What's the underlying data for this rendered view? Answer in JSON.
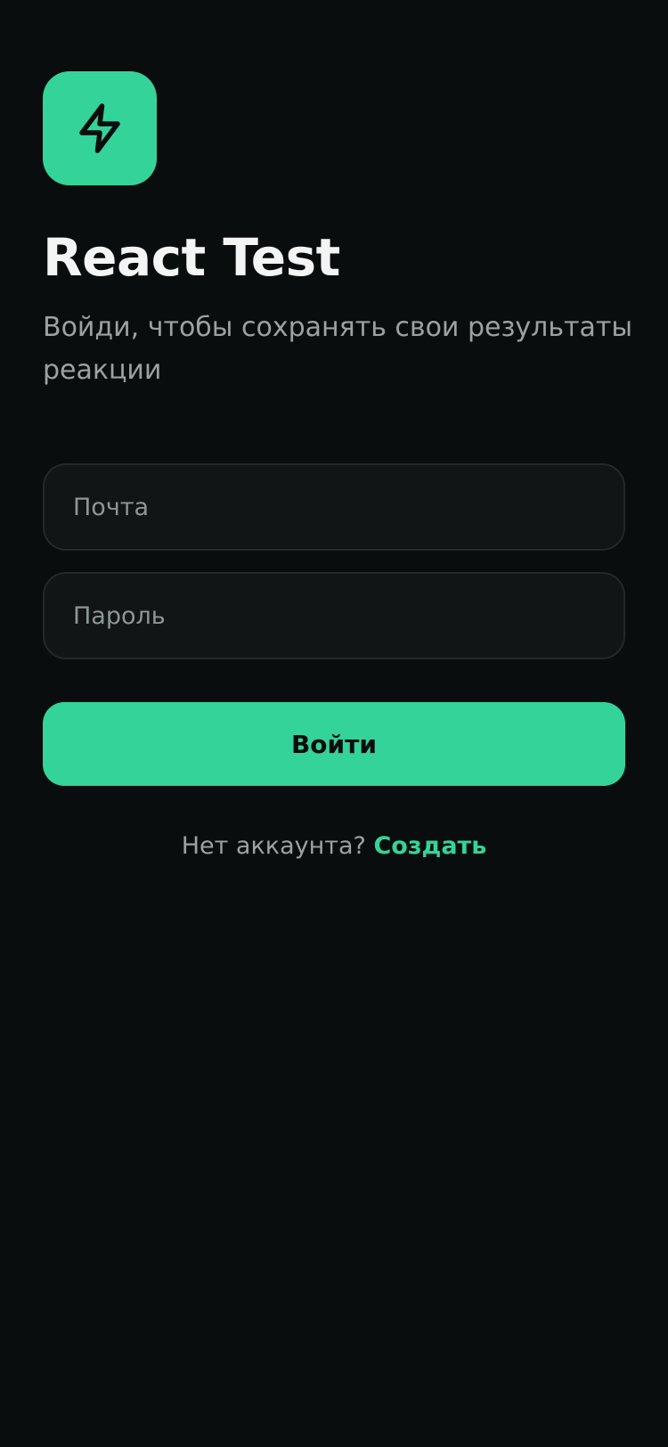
{
  "app": {
    "title": "React Test",
    "subtitle": "Войди, чтобы сохранять свои результаты реакции",
    "logo_icon": "lightning-bolt-icon"
  },
  "form": {
    "email": {
      "value": "",
      "placeholder": "Почта"
    },
    "password": {
      "value": "",
      "placeholder": "Пароль"
    },
    "submit_label": "Войти"
  },
  "footer": {
    "prompt": "Нет аккаунта?",
    "link_label": "Создать"
  },
  "colors": {
    "background": "#0a0d0d",
    "accent": "#34d399",
    "field_background": "#111515",
    "field_border": "#232828",
    "text_primary": "#f3f5f4",
    "text_secondary": "#9ba3a0"
  }
}
